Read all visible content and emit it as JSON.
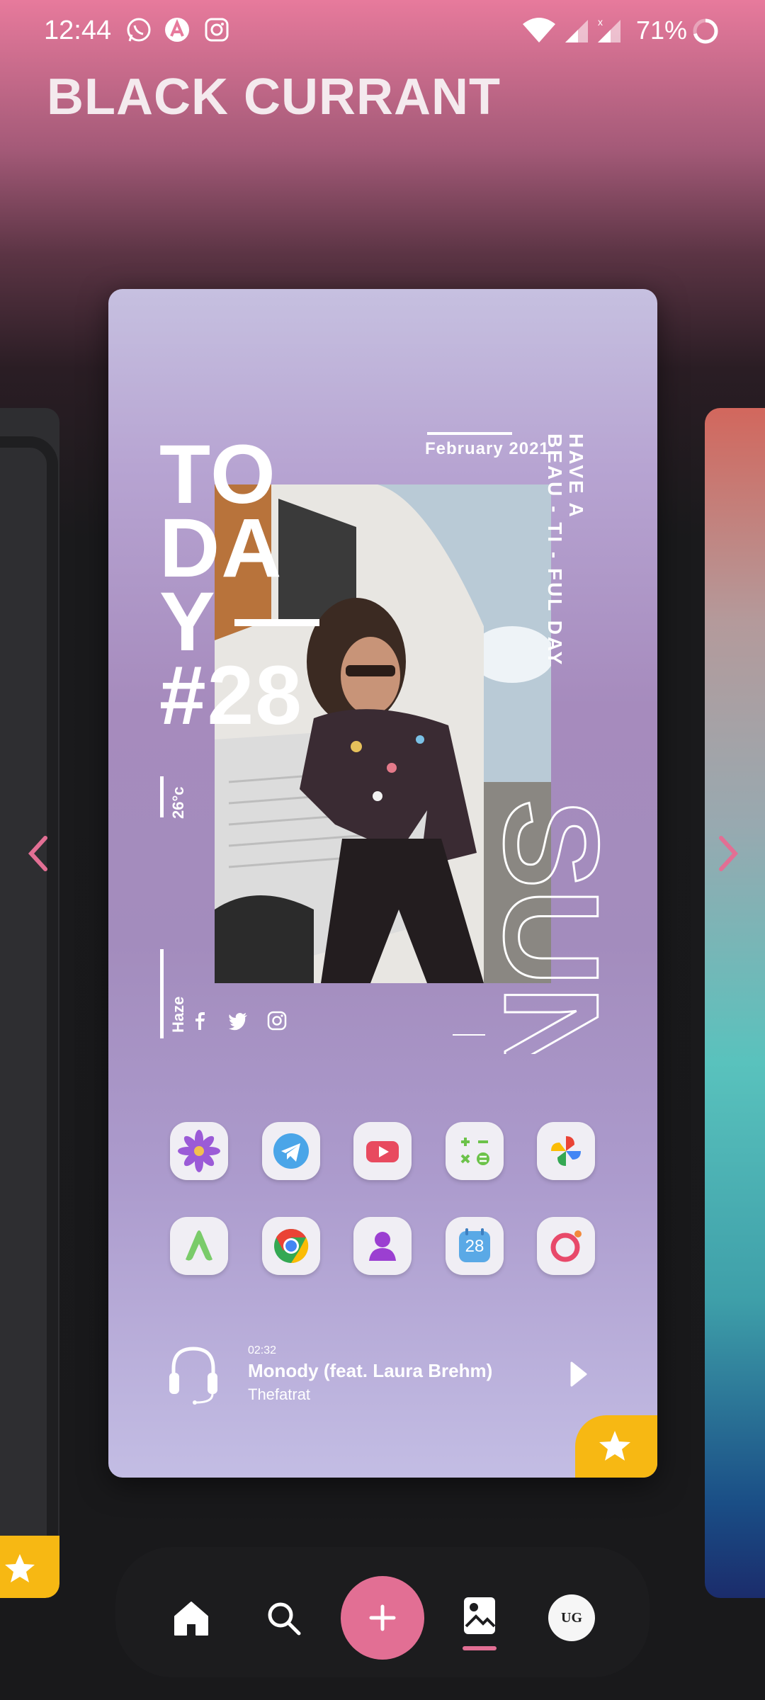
{
  "status_bar": {
    "time": "12:44",
    "notification_icons": [
      "whatsapp-icon",
      "app-a-icon",
      "instagram-icon"
    ],
    "battery_percent": "71%",
    "battery_level": 0.71
  },
  "app_title": "BLACK CURRANT",
  "card": {
    "today_lines": [
      "TO",
      "DA",
      "Y"
    ],
    "today_number": "#28",
    "date": "February 2021",
    "tagline_line1": "HAVE  A",
    "tagline_line2": "BEAU - TI - FUL  DAY",
    "temperature": "26°c",
    "weather": "Haze",
    "sun_word": "SUN",
    "social_icons": [
      "facebook-icon",
      "twitter-icon",
      "instagram-icon"
    ],
    "apps_row1": [
      "flower-icon",
      "telegram-icon",
      "youtube-icon",
      "calculator-icon",
      "photos-icon"
    ],
    "apps_row2": [
      "app-a-icon",
      "chrome-icon",
      "contacts-icon",
      "calendar-icon",
      "opera-icon"
    ],
    "calendar_day": "28",
    "music": {
      "time": "02:32",
      "title": "Monody (feat. Laura Brehm)",
      "artist": "Thefatrat"
    }
  },
  "nav": {
    "items": [
      "home-icon",
      "search-icon",
      "add-icon",
      "wallpaper-icon",
      "profile-avatar"
    ],
    "avatar_text": "UG",
    "accent": "#e26f94"
  },
  "colors": {
    "favorite_star": "#f7b813",
    "arrows": "#e26f94"
  }
}
